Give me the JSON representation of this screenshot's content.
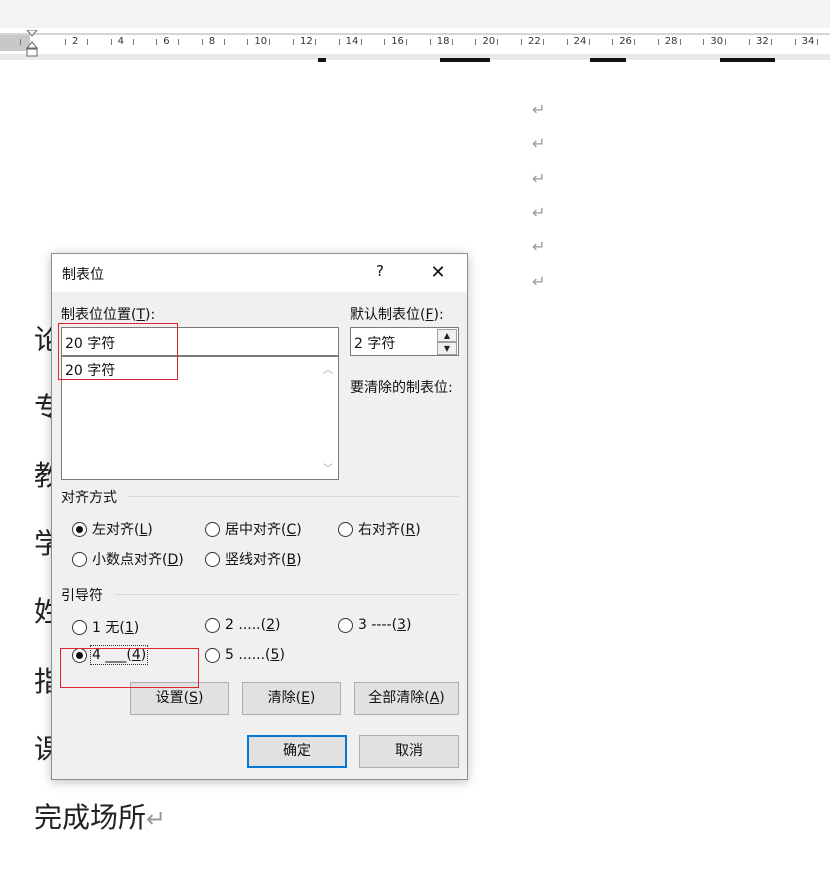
{
  "ruler": {
    "numbers": [
      "2",
      "4",
      "6",
      "8",
      "10",
      "12",
      "14",
      "16",
      "18",
      "20",
      "22",
      "24",
      "26",
      "28",
      "30",
      "32",
      "34"
    ]
  },
  "document": {
    "paragraph_mark": "↵",
    "left_chars": [
      "论",
      "专",
      "教",
      "学",
      "姓",
      "指",
      "课"
    ],
    "bottom_line": "完成场所"
  },
  "dialog": {
    "title": "制表位",
    "help": "?",
    "close": "✕",
    "tab_position_label_pre": "制表位位置(",
    "tab_position_label_key": "T",
    "tab_position_label_post": "):",
    "tab_position_value": "20 字符",
    "tab_list": [
      "20 字符"
    ],
    "default_tab_label_pre": "默认制表位(",
    "default_tab_label_key": "F",
    "default_tab_label_post": "):",
    "default_tab_value": "2 字符",
    "clear_label": "要清除的制表位:",
    "alignment_group": "对齐方式",
    "alignment": [
      {
        "pre": "左对齐(",
        "key": "L",
        "post": ")",
        "selected": true
      },
      {
        "pre": "居中对齐(",
        "key": "C",
        "post": ")",
        "selected": false
      },
      {
        "pre": "右对齐(",
        "key": "R",
        "post": ")",
        "selected": false
      },
      {
        "pre": "小数点对齐(",
        "key": "D",
        "post": ")",
        "selected": false
      },
      {
        "pre": "竖线对齐(",
        "key": "B",
        "post": ")",
        "selected": false
      }
    ],
    "leader_group": "引导符",
    "leader": [
      {
        "pre": "1 无(",
        "key": "1",
        "post": ")",
        "selected": false
      },
      {
        "pre": "2 .....(",
        "key": "2",
        "post": ")",
        "selected": false
      },
      {
        "pre": "3 ----(",
        "key": "3",
        "post": ")",
        "selected": false
      },
      {
        "pre": "4 ___(",
        "key": "4",
        "post": ")",
        "selected": true
      },
      {
        "pre": "5 ......(",
        "key": "5",
        "post": ")",
        "selected": false
      }
    ],
    "buttons": {
      "set_pre": "设置(",
      "set_key": "S",
      "set_post": ")",
      "clear_pre": "清除(",
      "clear_key": "E",
      "clear_post": ")",
      "clear_all_pre": "全部清除(",
      "clear_all_key": "A",
      "clear_all_post": ")",
      "ok": "确定",
      "cancel": "取消"
    }
  },
  "colors": {
    "highlight_box": "#e0252b",
    "default_button_border": "#0078d7"
  }
}
